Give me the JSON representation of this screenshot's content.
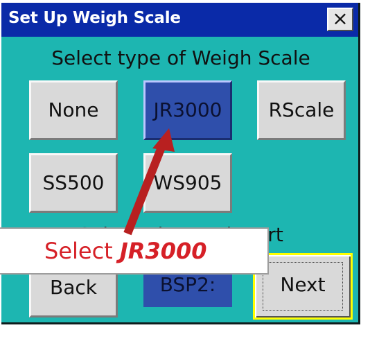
{
  "window": {
    "title": "Set Up Weigh Scale",
    "close_symbol": "×",
    "section_title": "Select type of Weigh Scale",
    "second_section_title": "Select Bluetooth Port",
    "buttons": {
      "none": "None",
      "jr3000": "JR3000",
      "rscale": "RScale",
      "ss500": "SS500",
      "ws905": "WS905",
      "back": "Back",
      "next": "Next"
    },
    "port_value": "BSP2:",
    "callout": {
      "prefix": "Select ",
      "emphasis": "JR3000"
    }
  },
  "colors": {
    "titlebar": "#0a2aa8",
    "window_background": "#1db6b1",
    "selected_button": "#2f4fab",
    "callout_text": "#d62027",
    "next_button_outline": "#ffff00"
  },
  "icons": {
    "close": "close-icon",
    "arrow": "annotation-arrow"
  }
}
